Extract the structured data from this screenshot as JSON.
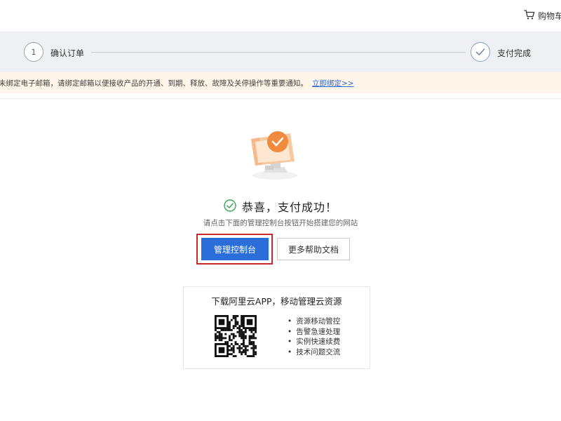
{
  "header": {
    "cart_label": "购物车"
  },
  "steps": [
    {
      "number": "1",
      "label": "确认订单"
    },
    {
      "number": "✓",
      "label": "支付完成"
    }
  ],
  "notice": {
    "text": "未绑定电子邮箱，请绑定邮箱以便接收产品的开通、到期、释放、故障及关停操作等重要通知。",
    "link": "立即绑定>>"
  },
  "success": {
    "title": "恭喜，支付成功！",
    "subtitle": "请点击下面的管理控制台按钮开始搭建您的网站"
  },
  "buttons": {
    "console": "管理控制台",
    "help_docs": "更多帮助文档"
  },
  "app_promo": {
    "title": "下载阿里云APP，移动管理云资源",
    "features": [
      "资源移动管控",
      "告警急速处理",
      "实例快速续费",
      "技术问题交流"
    ]
  },
  "colors": {
    "primary": "#2b6ed9",
    "highlight": "#c9282d",
    "success_green": "#3aa45a",
    "illustration_orange": "#f08a3c",
    "notice_bg": "#fff5e8",
    "steps_bg": "#eef0f3"
  }
}
